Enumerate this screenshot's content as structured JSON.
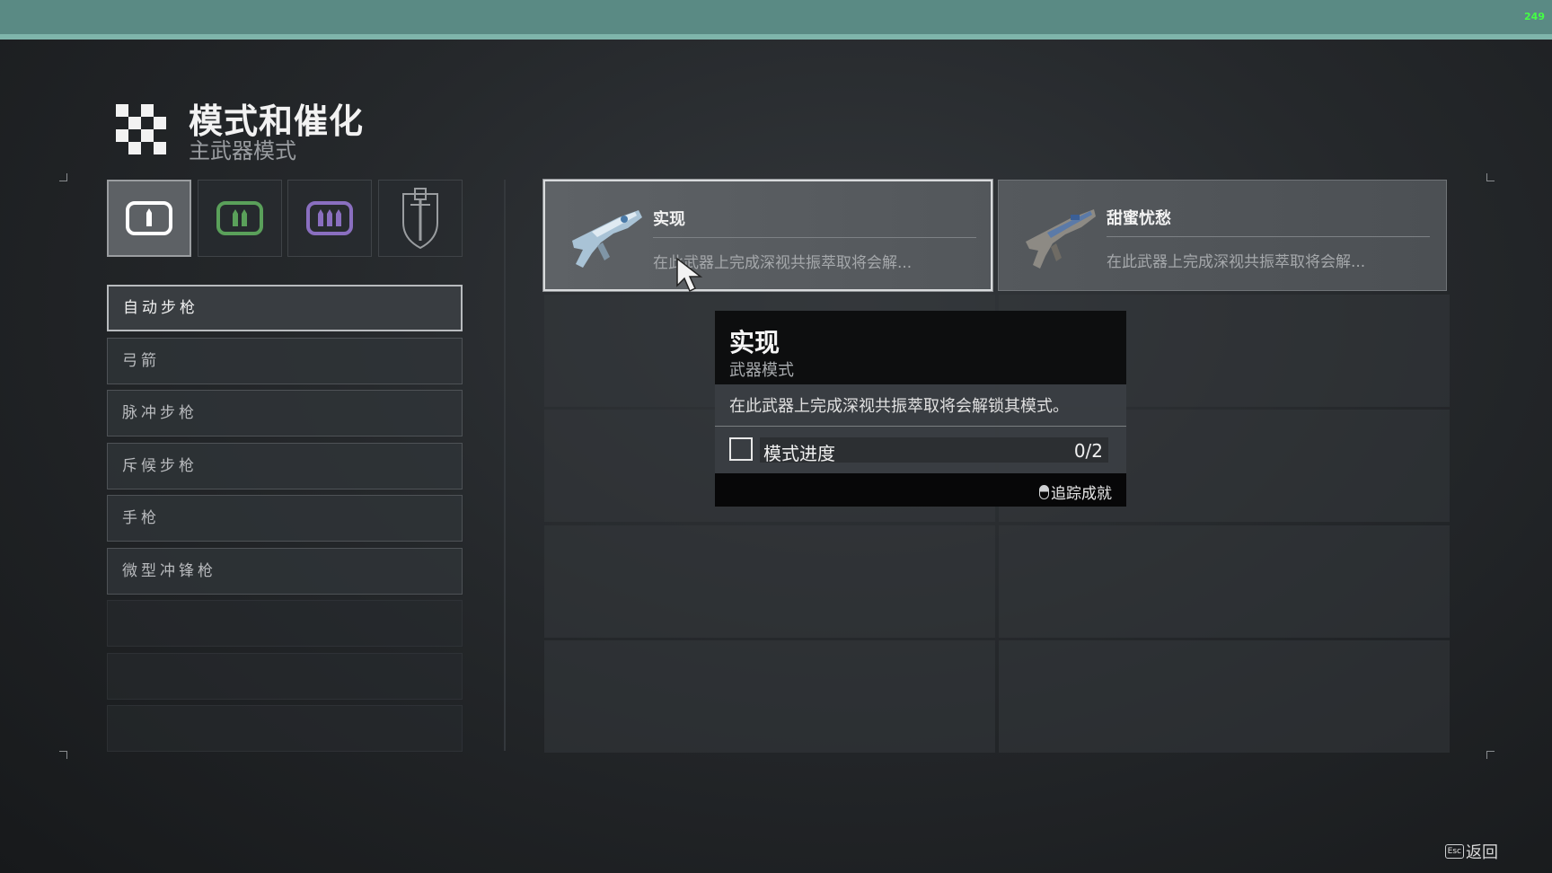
{
  "status": {
    "fps": "249"
  },
  "header": {
    "title": "模式和催化",
    "subtitle": "主武器模式",
    "icon": "checker-icon"
  },
  "tabs": [
    {
      "icon": "primary-ammo-icon",
      "color": "#ffffff",
      "active": true
    },
    {
      "icon": "special-ammo-icon",
      "color": "#5aa05a",
      "active": false
    },
    {
      "icon": "heavy-ammo-icon",
      "color": "#8a6fc0",
      "active": false
    },
    {
      "icon": "exotic-shield-icon",
      "color": "#9a9da0",
      "active": false
    }
  ],
  "categories": [
    {
      "label": "自动步枪",
      "selected": true
    },
    {
      "label": "弓箭",
      "selected": false
    },
    {
      "label": "脉冲步枪",
      "selected": false
    },
    {
      "label": "斥候步枪",
      "selected": false
    },
    {
      "label": "手枪",
      "selected": false
    },
    {
      "label": "微型冲锋枪",
      "selected": false
    }
  ],
  "mods": [
    {
      "name": "实现",
      "desc": "在此武器上完成深视共振萃取将会解...",
      "selected": true
    },
    {
      "name": "甜蜜忧愁",
      "desc": "在此武器上完成深视共振萃取将会解...",
      "selected": false
    }
  ],
  "tooltip": {
    "title": "实现",
    "subtitle": "武器模式",
    "description": "在此武器上完成深视共振萃取将会解锁其模式。",
    "progress_label": "模式进度",
    "progress_value": "0/2",
    "progress_fraction": 0,
    "track_label": "追踪成就"
  },
  "footer": {
    "esc_key": "Esc",
    "back_label": "返回"
  }
}
